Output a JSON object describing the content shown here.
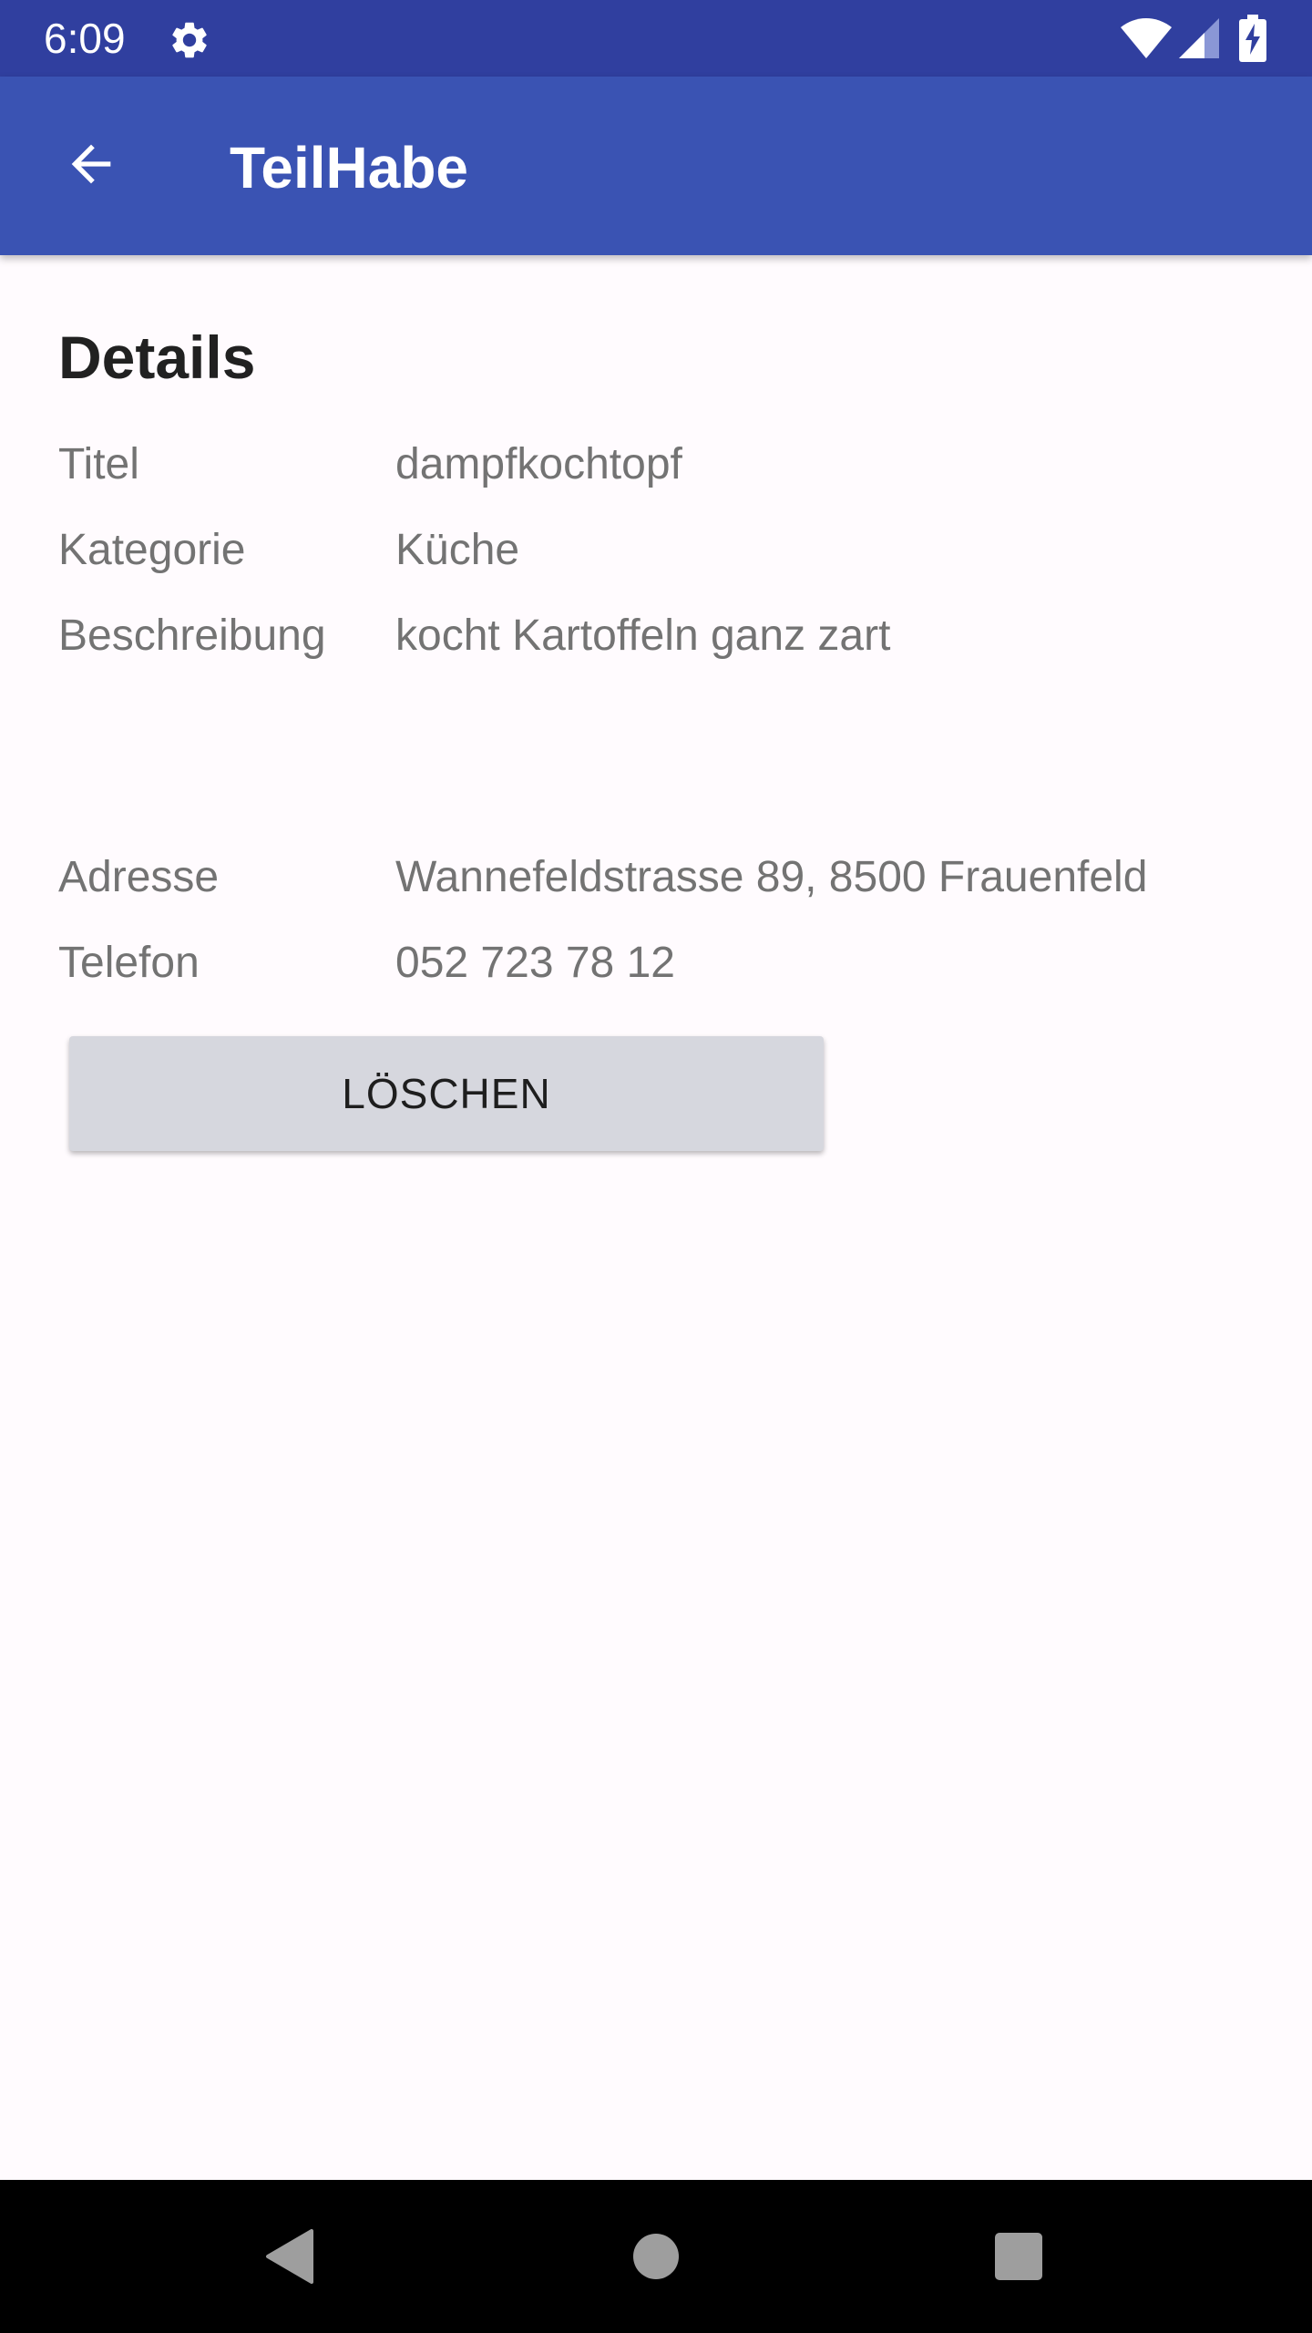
{
  "status_bar": {
    "time": "6:09",
    "icons": [
      "gear-icon",
      "wifi-icon",
      "signal-icon",
      "battery-charging-icon"
    ],
    "background": "#303F9F"
  },
  "app_bar": {
    "title": "TeilHabe",
    "back_icon": "arrow-left-icon",
    "background": "#3A53B3"
  },
  "details": {
    "heading": "Details",
    "rows": [
      {
        "label": "Titel",
        "value": "dampfkochtopf"
      },
      {
        "label": "Kategorie",
        "value": "Küche"
      },
      {
        "label": "Beschreibung",
        "value": "kocht Kartoffeln ganz zart"
      },
      {
        "label": "Adresse",
        "value": "Wannefeldstrasse 89, 8500 Frauenfeld"
      },
      {
        "label": "Telefon",
        "value": "052 723 78 12"
      }
    ]
  },
  "actions": {
    "delete_label": "LÖSCHEN"
  },
  "nav_bar": {
    "icons": [
      "nav-back-icon",
      "nav-home-icon",
      "nav-recents-icon"
    ]
  }
}
